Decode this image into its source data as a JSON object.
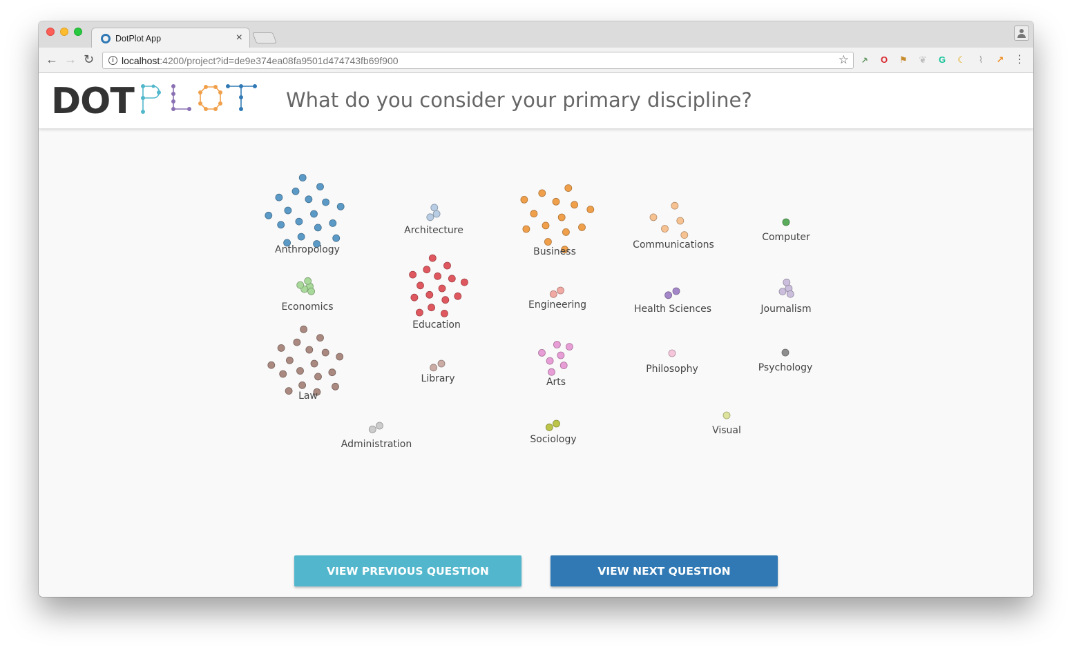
{
  "browser": {
    "tab_title": "DotPlot App",
    "tab_close": "×",
    "url_host": "localhost",
    "url_rest": ":4200/project?id=de9e374ea08fa9501d474743fb69f900",
    "nav": {
      "back": "←",
      "forward": "→",
      "reload": "↻"
    },
    "star": "☆",
    "menu": "⋮",
    "info": "i",
    "extensions": [
      {
        "name": "tool-extension-icon",
        "glyph": "⸕",
        "color": "#3a7d3a"
      },
      {
        "name": "opera-extension-icon",
        "glyph": "O",
        "color": "#d8222a"
      },
      {
        "name": "flag-extension-icon",
        "glyph": "⚑",
        "color": "#c78b2d"
      },
      {
        "name": "leaf-extension-icon",
        "glyph": "❦",
        "color": "#bdbdbd"
      },
      {
        "name": "grammarly-extension-icon",
        "glyph": "G",
        "color": "#15c39a"
      },
      {
        "name": "moon-extension-icon",
        "glyph": "☾",
        "color": "#e2a60d"
      },
      {
        "name": "paint-extension-icon",
        "glyph": "⌇",
        "color": "#b0b0b0"
      },
      {
        "name": "chart-extension-icon",
        "glyph": "↗",
        "color": "#f08b1d"
      }
    ]
  },
  "app": {
    "logo_text": "DOT",
    "logo_plot_name": "PLOT",
    "question": "What do you consider your primary discipline?",
    "prev_button": "VIEW PREVIOUS QUESTION",
    "next_button": "VIEW NEXT QUESTION"
  },
  "clusters": [
    {
      "label": "Anthropology",
      "color": "#5b9ac6",
      "count": 18
    },
    {
      "label": "Architecture",
      "color": "#b8cde4",
      "count": 3
    },
    {
      "label": "Business",
      "color": "#f0a04b",
      "count": 14
    },
    {
      "label": "Communications",
      "color": "#f7c292",
      "count": 5
    },
    {
      "label": "Computer",
      "color": "#5aac5c",
      "count": 1
    },
    {
      "label": "Economics",
      "color": "#a8d99a",
      "count": 5
    },
    {
      "label": "Education",
      "color": "#e0585f",
      "count": 16
    },
    {
      "label": "Engineering",
      "color": "#f1a9a3",
      "count": 2
    },
    {
      "label": "Health Sciences",
      "color": "#a487c9",
      "count": 2
    },
    {
      "label": "Journalism",
      "color": "#cbbedd",
      "count": 4
    },
    {
      "label": "Law",
      "color": "#a98980",
      "count": 18
    },
    {
      "label": "Library",
      "color": "#caaca5",
      "count": 2
    },
    {
      "label": "Arts",
      "color": "#e79dd5",
      "count": 7
    },
    {
      "label": "Philosophy",
      "color": "#f5c5da",
      "count": 1
    },
    {
      "label": "Psychology",
      "color": "#8e8e8e",
      "count": 1
    },
    {
      "label": "Administration",
      "color": "#cccccc",
      "count": 2
    },
    {
      "label": "Sociology",
      "color": "#bcc44a",
      "count": 2
    },
    {
      "label": "Visual",
      "color": "#dde39d",
      "count": 1
    }
  ]
}
